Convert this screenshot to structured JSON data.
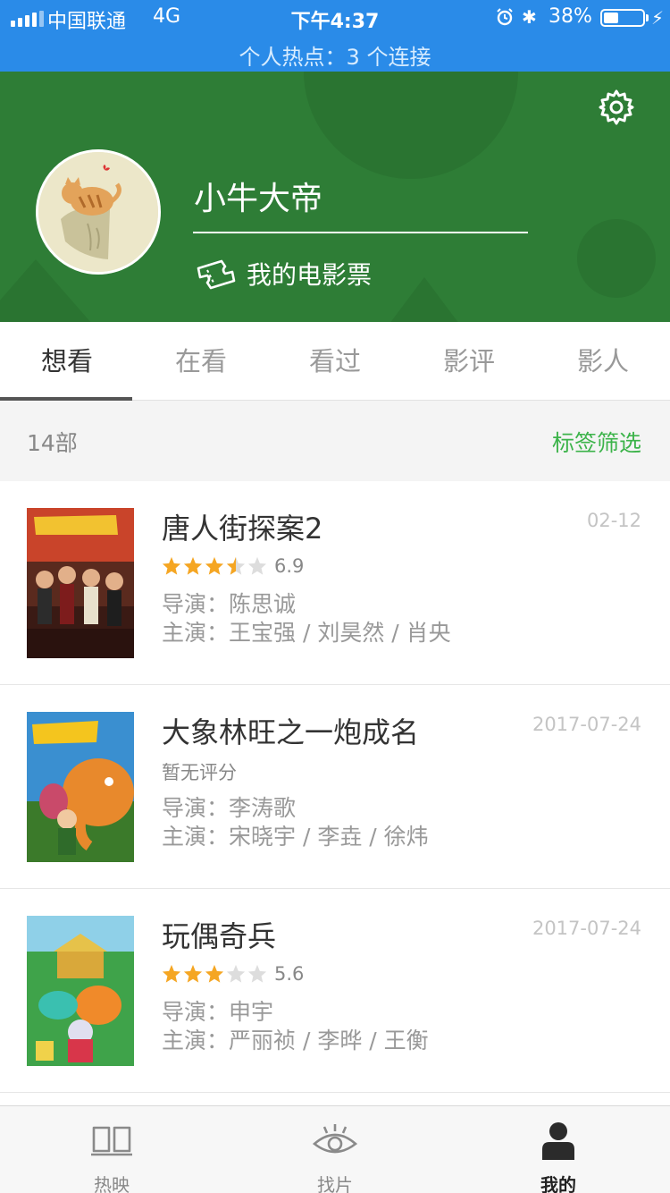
{
  "status_bar": {
    "carrier": "中国联通",
    "network": "4G",
    "time": "下午4:37",
    "battery_percent": "38%",
    "battery_level": 0.38,
    "hotspot": "个人热点：3 个连接"
  },
  "profile": {
    "username": "小牛大帝",
    "tickets_label": "我的电影票"
  },
  "tabs": [
    {
      "label": "想看"
    },
    {
      "label": "在看"
    },
    {
      "label": "看过"
    },
    {
      "label": "影评"
    },
    {
      "label": "影人"
    }
  ],
  "active_tab": 0,
  "list_header": {
    "count": "14部",
    "filter": "标签筛选"
  },
  "movies": [
    {
      "title": "唐人街探案2",
      "date": "02-12",
      "stars": 3.5,
      "score": "6.9",
      "no_rating": "",
      "director": "导演：陈思诚",
      "cast": "主演：王宝强 / 刘昊然 / 肖央"
    },
    {
      "title": "大象林旺之一炮成名",
      "date": "2017-07-24",
      "stars": 0,
      "score": "",
      "no_rating": "暂无评分",
      "director": "导演：李涛歌",
      "cast": "主演：宋晓宇 / 李垚 / 徐炜"
    },
    {
      "title": "玩偶奇兵",
      "date": "2017-07-24",
      "stars": 3,
      "score": "5.6",
      "no_rating": "",
      "director": "导演：申宇",
      "cast": "主演：严丽祯 / 李晔 / 王衡"
    }
  ],
  "bottom_nav": [
    {
      "label": "热映",
      "icon": "book-icon"
    },
    {
      "label": "找片",
      "icon": "eye-icon"
    },
    {
      "label": "我的",
      "icon": "person-icon"
    }
  ],
  "active_nav": 2,
  "colors": {
    "status_bar": "#2a8be8",
    "header": "#2e7d36",
    "accent_green": "#3cb34a",
    "star": "#f5a623",
    "star_empty": "#dddddd"
  }
}
